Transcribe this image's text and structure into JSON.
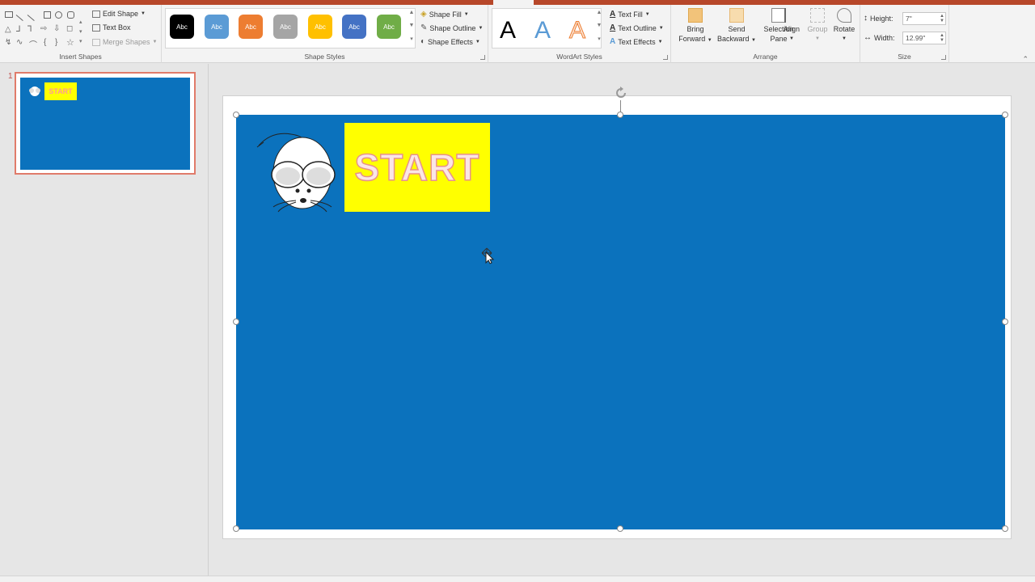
{
  "ribbon": {
    "insert_shapes": {
      "group_label": "Insert Shapes",
      "edit_shape": "Edit Shape",
      "text_box": "Text Box",
      "merge_shapes": "Merge Shapes"
    },
    "shape_styles": {
      "group_label": "Shape Styles",
      "swatches": [
        {
          "label": "Abc",
          "color": "#000000"
        },
        {
          "label": "Abc",
          "color": "#5b9bd5"
        },
        {
          "label": "Abc",
          "color": "#ed7d31"
        },
        {
          "label": "Abc",
          "color": "#a5a5a5"
        },
        {
          "label": "Abc",
          "color": "#ffc000"
        },
        {
          "label": "Abc",
          "color": "#4472c4"
        },
        {
          "label": "Abc",
          "color": "#70ad47"
        }
      ],
      "shape_fill": "Shape Fill",
      "shape_outline": "Shape Outline",
      "shape_effects": "Shape Effects"
    },
    "wordart": {
      "group_label": "WordArt Styles",
      "samples": [
        {
          "letter": "A",
          "color": "#000000"
        },
        {
          "letter": "A",
          "color": "#5b9bd5"
        },
        {
          "letter": "A",
          "color": "#f4b183"
        }
      ],
      "text_fill": "Text Fill",
      "text_outline": "Text Outline",
      "text_effects": "Text Effects"
    },
    "arrange": {
      "group_label": "Arrange",
      "bring_forward": [
        "Bring",
        "Forward"
      ],
      "send_backward": [
        "Send",
        "Backward"
      ],
      "selection_pane": [
        "Selection",
        "Pane"
      ],
      "align": "Align",
      "group": "Group",
      "rotate": "Rotate"
    },
    "size": {
      "group_label": "Size",
      "height_label": "Height:",
      "height_value": "7\"",
      "width_label": "Width:",
      "width_value": "12.99\""
    }
  },
  "thumbnails": [
    {
      "number": "1",
      "start_text": "START"
    }
  ],
  "slide": {
    "start_text": "START",
    "background_color": "#0b72bd",
    "start_box_color": "#ffff00"
  }
}
